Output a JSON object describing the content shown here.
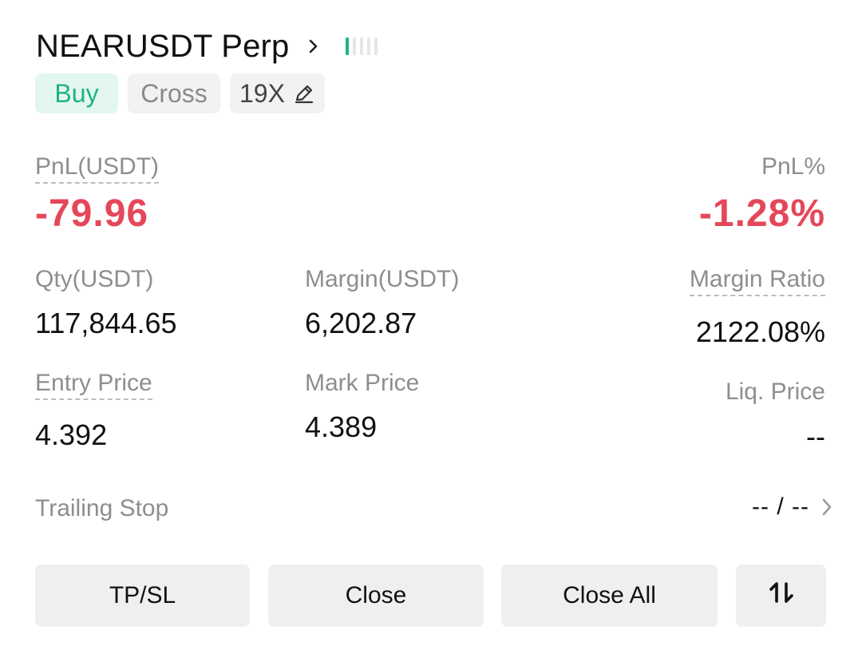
{
  "header": {
    "symbol": "NEARUSDT Perp",
    "signal_bars_active": 1,
    "signal_bars_total": 5
  },
  "tags": {
    "side": "Buy",
    "margin_mode": "Cross",
    "leverage": "19X"
  },
  "pnl": {
    "label": "PnL(USDT)",
    "value": "-79.96",
    "pct_label": "PnL%",
    "pct_value": "-1.28%"
  },
  "fields": {
    "qty_label": "Qty(USDT)",
    "qty_value": "117,844.65",
    "margin_label": "Margin(USDT)",
    "margin_value": "6,202.87",
    "margin_ratio_label": "Margin Ratio",
    "margin_ratio_value": "2122.08%",
    "entry_label": "Entry Price",
    "entry_value": "4.392",
    "mark_label": "Mark Price",
    "mark_value": "4.389",
    "liq_label": "Liq. Price",
    "liq_value": "--"
  },
  "trailing": {
    "label": "Trailing Stop",
    "value": "-- / --"
  },
  "actions": {
    "tpsl": "TP/SL",
    "close": "Close",
    "close_all": "Close All"
  },
  "colors": {
    "positive": "#1fb380",
    "negative": "#e5475a",
    "muted": "#8e8e8e"
  }
}
